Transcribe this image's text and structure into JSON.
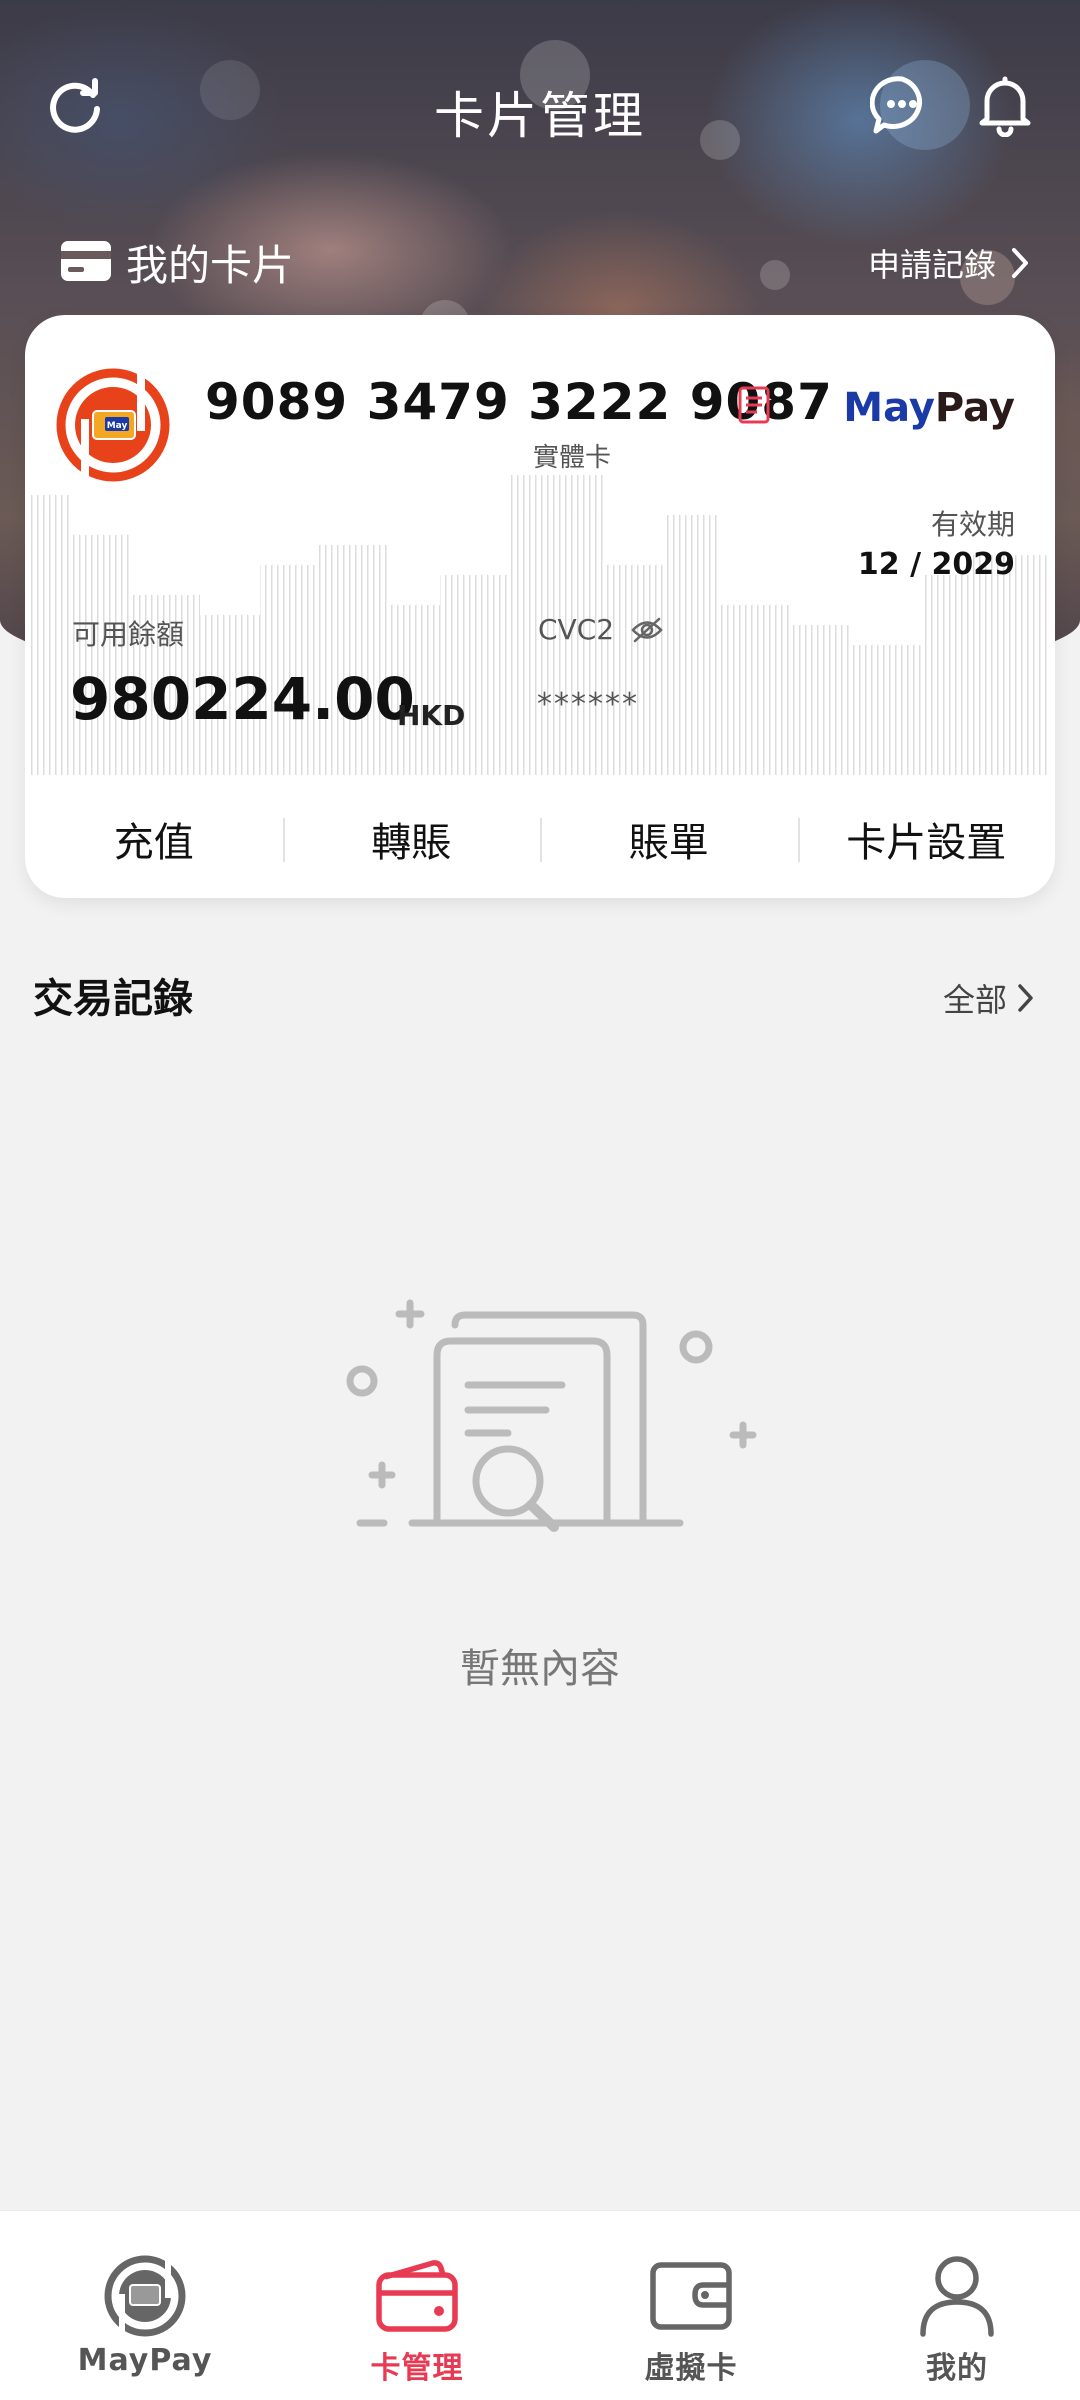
{
  "header": {
    "title": "卡片管理",
    "icons": [
      "refresh-icon",
      "chat-icon",
      "bell-icon"
    ]
  },
  "my_cards": {
    "title": "我的卡片",
    "apply_record": "申請記錄"
  },
  "card": {
    "number": "9089 3479 3222 9087",
    "type": "實體卡",
    "brand_may": "May",
    "brand_pay": "Pay",
    "expiry_label": "有效期",
    "expiry_value": "12 / 2029",
    "balance_label": "可用餘額",
    "balance_value": "980224.00",
    "currency": "HKD",
    "cvc_label": "CVC2",
    "cvc_value": "******",
    "logo_text": "May",
    "actions": [
      "充值",
      "轉賬",
      "賬單",
      "卡片設置"
    ]
  },
  "transactions": {
    "title": "交易記錄",
    "all_label": "全部",
    "empty_text": "暫無內容"
  },
  "bottom_nav": {
    "items": [
      {
        "label": "MayPay",
        "icon": "maypay-icon",
        "active": false
      },
      {
        "label": "卡管理",
        "icon": "card-icon",
        "active": true
      },
      {
        "label": "虛擬卡",
        "icon": "wallet-icon",
        "active": false
      },
      {
        "label": "我的",
        "icon": "profile-icon",
        "active": false
      }
    ]
  },
  "colors": {
    "accent": "#e83a52",
    "brand_blue": "#1a3aa8",
    "logo_orange": "#e8421a",
    "background": "#f2f2f2"
  }
}
